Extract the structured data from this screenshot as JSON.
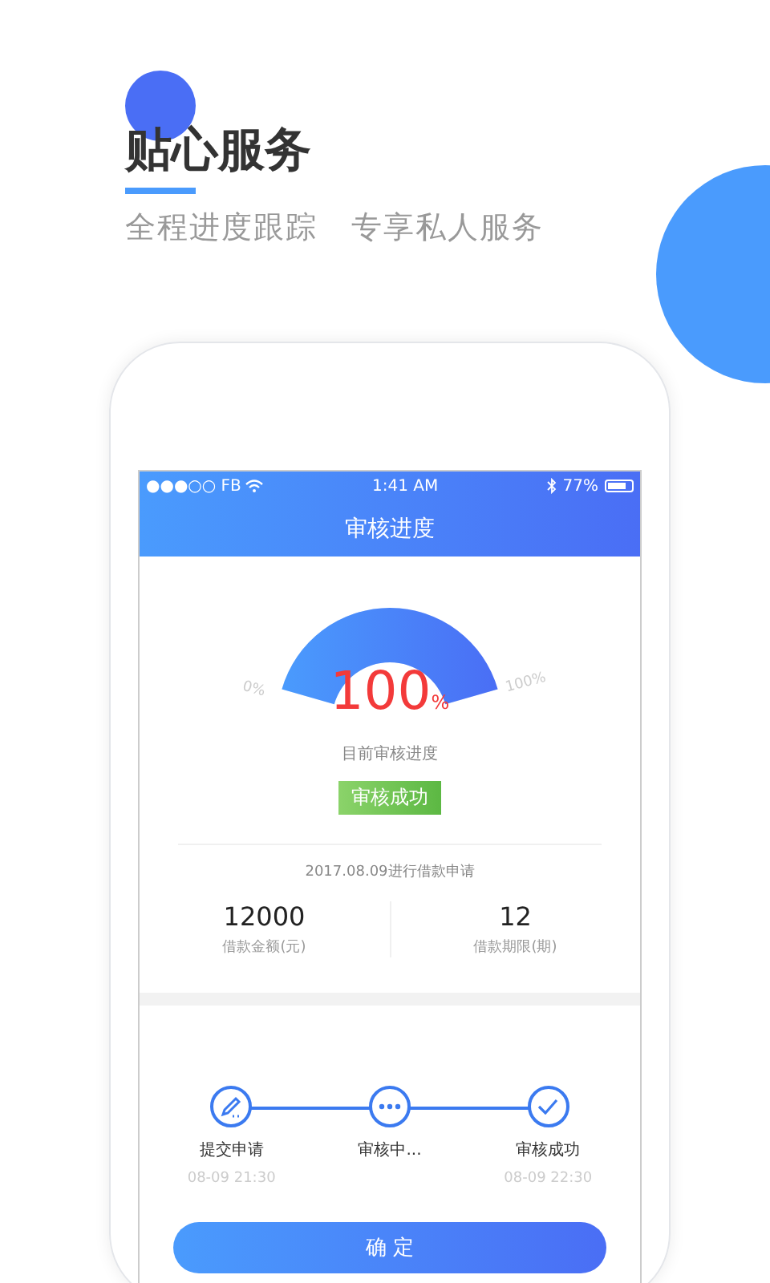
{
  "header": {
    "title": "贴心服务",
    "subtitle": "全程进度跟踪   专享私人服务"
  },
  "status_bar": {
    "carrier": "●●●○○ FB",
    "time": "1:41 AM",
    "battery": "77%"
  },
  "nav": {
    "title": "审核进度"
  },
  "gauge": {
    "level": 1,
    "min_label": "0%",
    "max_label": "100%",
    "value": "100",
    "unit": "%",
    "caption": "目前审核进度",
    "badge": "审核成功"
  },
  "application": {
    "date": "2017.08.09进行借款申请"
  },
  "stats": [
    {
      "value": "12000",
      "label": "借款金额(元)"
    },
    {
      "value": "12",
      "label": "借款期限(期)"
    }
  ],
  "steps": [
    {
      "kind": "edit",
      "label": "提交申请",
      "time": "08-09 21:30"
    },
    {
      "kind": "pending",
      "label": "审核中..."
    },
    {
      "kind": "done",
      "label": "审核成功",
      "time": "08-09 22:30"
    }
  ],
  "confirm_button": "确 定"
}
